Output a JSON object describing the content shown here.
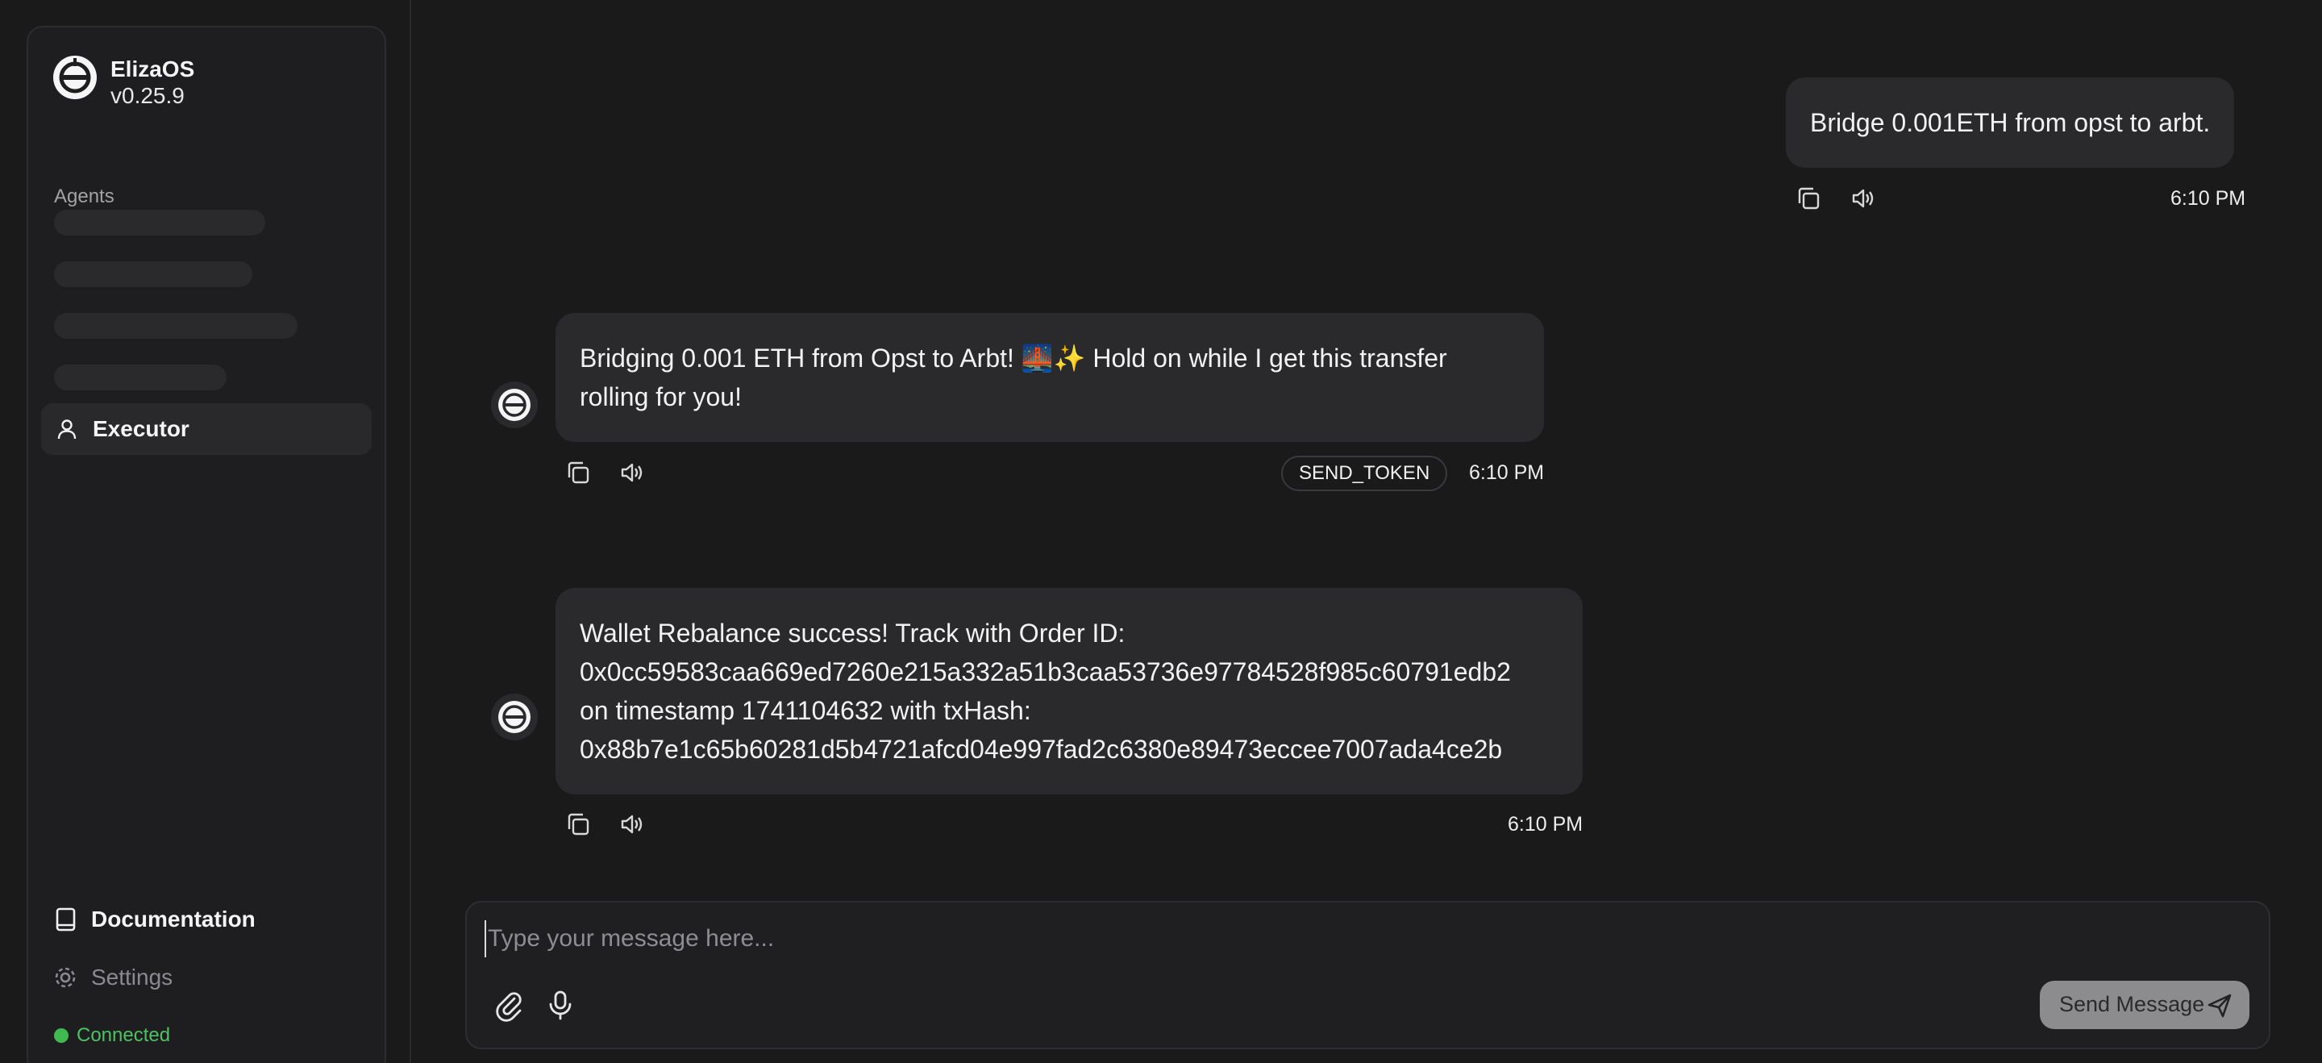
{
  "brand": {
    "name": "ElizaOS",
    "version": "v0.25.9"
  },
  "sidebar": {
    "agents_heading": "Agents",
    "agents": [
      {
        "label": "Executor",
        "icon": "user-icon",
        "active": true
      }
    ],
    "nav": [
      {
        "label": "Documentation",
        "icon": "book-icon"
      },
      {
        "label": "Settings",
        "icon": "gear-icon"
      }
    ],
    "status": {
      "label": "Connected",
      "color": "#3fb950"
    }
  },
  "messages": [
    {
      "role": "user",
      "lines": [
        "Bridge 0.001ETH from opst to arbt."
      ],
      "time": "6:10 PM"
    },
    {
      "role": "agent",
      "lines": [
        "Bridging 0.001 ETH from Opst to Arbt! 🌉✨ Hold on while I get this transfer",
        "rolling for you!"
      ],
      "action": "SEND_TOKEN",
      "time": "6:10 PM"
    },
    {
      "role": "agent",
      "lines": [
        "Wallet Rebalance success! Track with Order ID:",
        "0x0cc59583caa669ed7260e215a332a51b3caa53736e97784528f985c60791edb2",
        "on timestamp 1741104632 with txHash:",
        "0x88b7e1c65b60281d5b4721afcd04e997fad2c6380e89473eccee7007ada4ce2b"
      ],
      "time": "6:10 PM"
    }
  ],
  "composer": {
    "placeholder": "Type your message here...",
    "value": "",
    "send_label": "Send Message"
  },
  "colors": {
    "background": "#1a1a1b",
    "bubble": "#2a2a2d",
    "status_connected": "#3fb950",
    "send_button": "#8c8c8f"
  }
}
